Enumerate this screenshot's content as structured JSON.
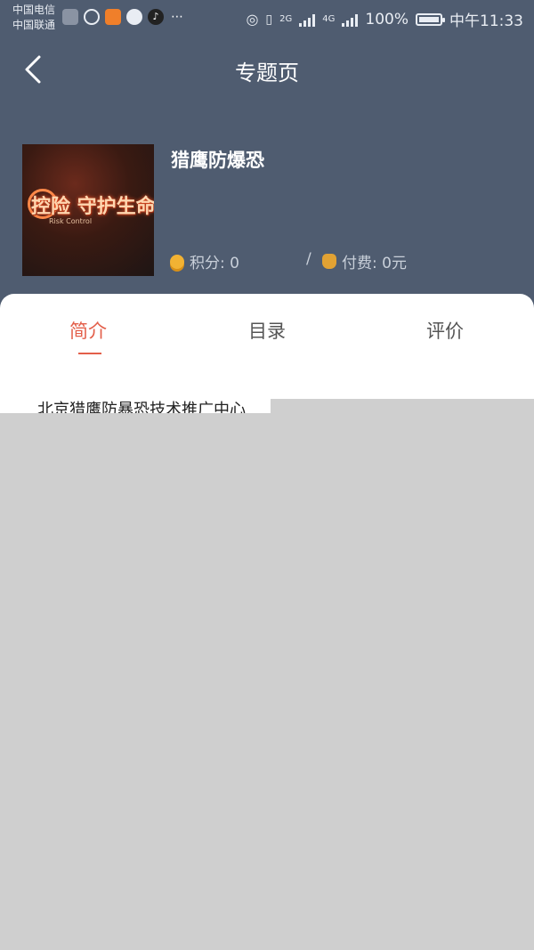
{
  "status_bar": {
    "carrier_1": "中国电信",
    "carrier_2": "中国联通",
    "battery": "100%",
    "time": "中午11:33",
    "network_2g": "2G",
    "network_4g": "4G"
  },
  "nav": {
    "title": "专题页"
  },
  "topic": {
    "name": "猎鹰防爆恐",
    "cover_text": "控险 守护生命",
    "cover_subtext": "Risk Control",
    "points_label": "积分: 0",
    "fee_label": "付费: 0元",
    "separator": "/"
  },
  "tabs": [
    {
      "label": "简介",
      "active": true
    },
    {
      "label": "目录",
      "active": false
    },
    {
      "label": "评价",
      "active": false
    }
  ],
  "intro": {
    "text": "北京猎鹰防暴恐技术推广中心"
  },
  "colors": {
    "header_bg": "#4f5c70",
    "accent": "#e35f4a"
  }
}
